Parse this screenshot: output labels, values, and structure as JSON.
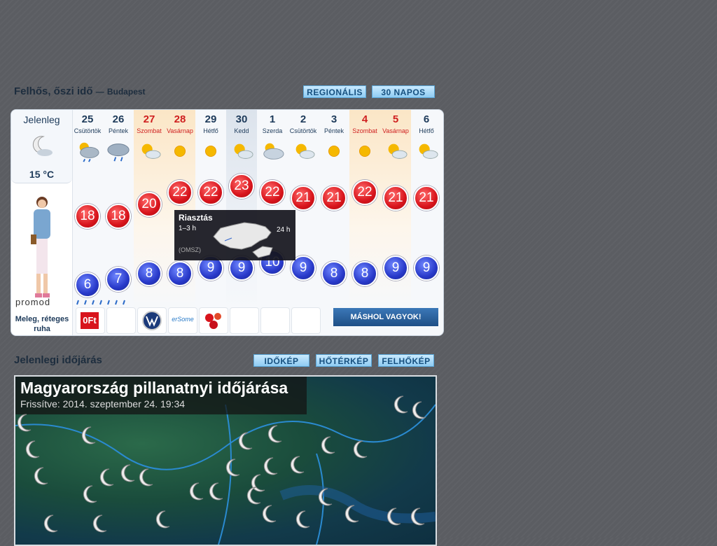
{
  "forecast": {
    "title": "Felhős, őszi idő",
    "dash": "—",
    "city": "Budapest",
    "btn_regional": "REGIONÁLIS",
    "btn_30": "30 NAPOS",
    "now_label": "Jelenleg",
    "now_temp": "15 °C",
    "tip": "Meleg, réteges ruha",
    "ad_brand": "promod",
    "elsewhere": "MÁSHOL VAGYOK!",
    "days": [
      {
        "num": "25",
        "name": "Csütörtök",
        "max": "18",
        "min": "6",
        "weekend": false,
        "icon": "cloudy-sun-rain-icon"
      },
      {
        "num": "26",
        "name": "Péntek",
        "max": "18",
        "min": "7",
        "weekend": false,
        "icon": "cloud-rain-icon"
      },
      {
        "num": "27",
        "name": "Szombat",
        "max": "20",
        "min": "8",
        "weekend": true,
        "icon": "partly-sunny-icon"
      },
      {
        "num": "28",
        "name": "Vasárnap",
        "max": "22",
        "min": "8",
        "weekend": true,
        "icon": "sun-icon"
      },
      {
        "num": "29",
        "name": "Hétfő",
        "max": "22",
        "min": "9",
        "weekend": false,
        "icon": "sun-icon"
      },
      {
        "num": "30",
        "name": "Kedd",
        "max": "23",
        "min": "9",
        "weekend": false,
        "icon": "partly-sunny-icon"
      },
      {
        "num": "1",
        "name": "Szerda",
        "max": "22",
        "min": "10",
        "weekend": false,
        "icon": "partly-cloudy-icon"
      },
      {
        "num": "2",
        "name": "Csütörtök",
        "max": "21",
        "min": "9",
        "weekend": false,
        "icon": "partly-sunny-icon"
      },
      {
        "num": "3",
        "name": "Péntek",
        "max": "21",
        "min": "8",
        "weekend": false,
        "icon": "sun-icon"
      },
      {
        "num": "4",
        "name": "Szombat",
        "max": "22",
        "min": "8",
        "weekend": true,
        "icon": "sun-icon"
      },
      {
        "num": "5",
        "name": "Vasárnap",
        "max": "21",
        "min": "9",
        "weekend": true,
        "icon": "partly-sunny-icon"
      },
      {
        "num": "6",
        "name": "Hétfő",
        "max": "21",
        "min": "9",
        "weekend": false,
        "icon": "partly-sunny-icon"
      }
    ],
    "popup": {
      "title": "Riasztás",
      "range1": "1–3 h",
      "range2": "24 h",
      "source": "(OMSZ)"
    },
    "ads": [
      {
        "label": "0Ft",
        "icon": "zero-ft-logo-icon"
      },
      {
        "label": "",
        "icon": "empty-ad-slot-icon"
      },
      {
        "label": "",
        "icon": "volkswagen-logo-icon"
      },
      {
        "label": "erSome",
        "icon": "ersome-logo-icon"
      },
      {
        "label": "",
        "icon": "flower-logo-icon"
      },
      {
        "label": "",
        "icon": "empty-ad-slot-icon"
      },
      {
        "label": "",
        "icon": "empty-ad-slot-icon"
      },
      {
        "label": "",
        "icon": "empty-ad-slot-icon"
      }
    ]
  },
  "current": {
    "title": "Jelenlegi időjárás",
    "btn_idokep": "IDŐKÉP",
    "btn_hoterkep": "HŐTÉRKÉP",
    "btn_felhokep": "FELHŐKÉP",
    "map_title": "Magyarország pillanatnyi időjárása",
    "map_updated": "Frissítve: 2014. szeptember 24. 19:34"
  },
  "colors": {
    "max": "#d8141c",
    "min": "#2839c9",
    "weekend": "#cf1f1f",
    "text": "#1d3a5a"
  }
}
